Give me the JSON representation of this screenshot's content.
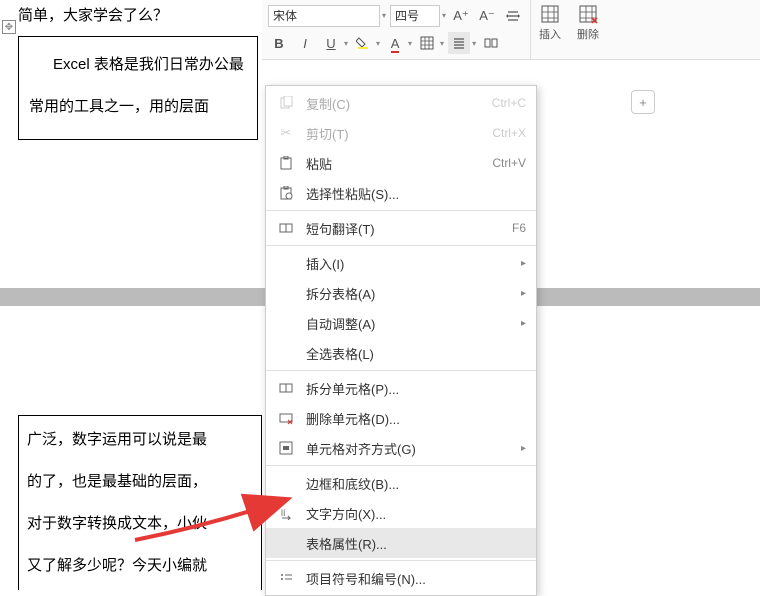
{
  "ribbon": {
    "font_name": "宋体",
    "font_size": "四号",
    "insert_label": "插入",
    "delete_label": "删除"
  },
  "doc": {
    "line1": "简单，大家学会了么？",
    "table1_line1": "Excel 表格是我们日常办公最",
    "table1_line2": "常用的工具之一，用的层面",
    "table2_line1": "广泛，数字运用可以说是最",
    "table2_line2": "的了，也是最基础的层面，",
    "table2_line3": "对于数字转换成文本，小伙",
    "table2_line4": "又了解多少呢？今天小编就"
  },
  "menu": {
    "copy": "复制(C)",
    "copy_sc": "Ctrl+C",
    "cut": "剪切(T)",
    "cut_sc": "Ctrl+X",
    "paste": "粘贴",
    "paste_sc": "Ctrl+V",
    "paste_special": "选择性粘贴(S)...",
    "translate": "短句翻译(T)",
    "translate_sc": "F6",
    "insert": "插入(I)",
    "split_table": "拆分表格(A)",
    "auto_fit": "自动调整(A)",
    "select_all": "全选表格(L)",
    "split_cell": "拆分单元格(P)...",
    "delete_cell": "删除单元格(D)...",
    "align": "单元格对齐方式(G)",
    "border": "边框和底纹(B)...",
    "text_dir": "文字方向(X)...",
    "table_props": "表格属性(R)...",
    "bullets": "项目符号和编号(N)..."
  }
}
